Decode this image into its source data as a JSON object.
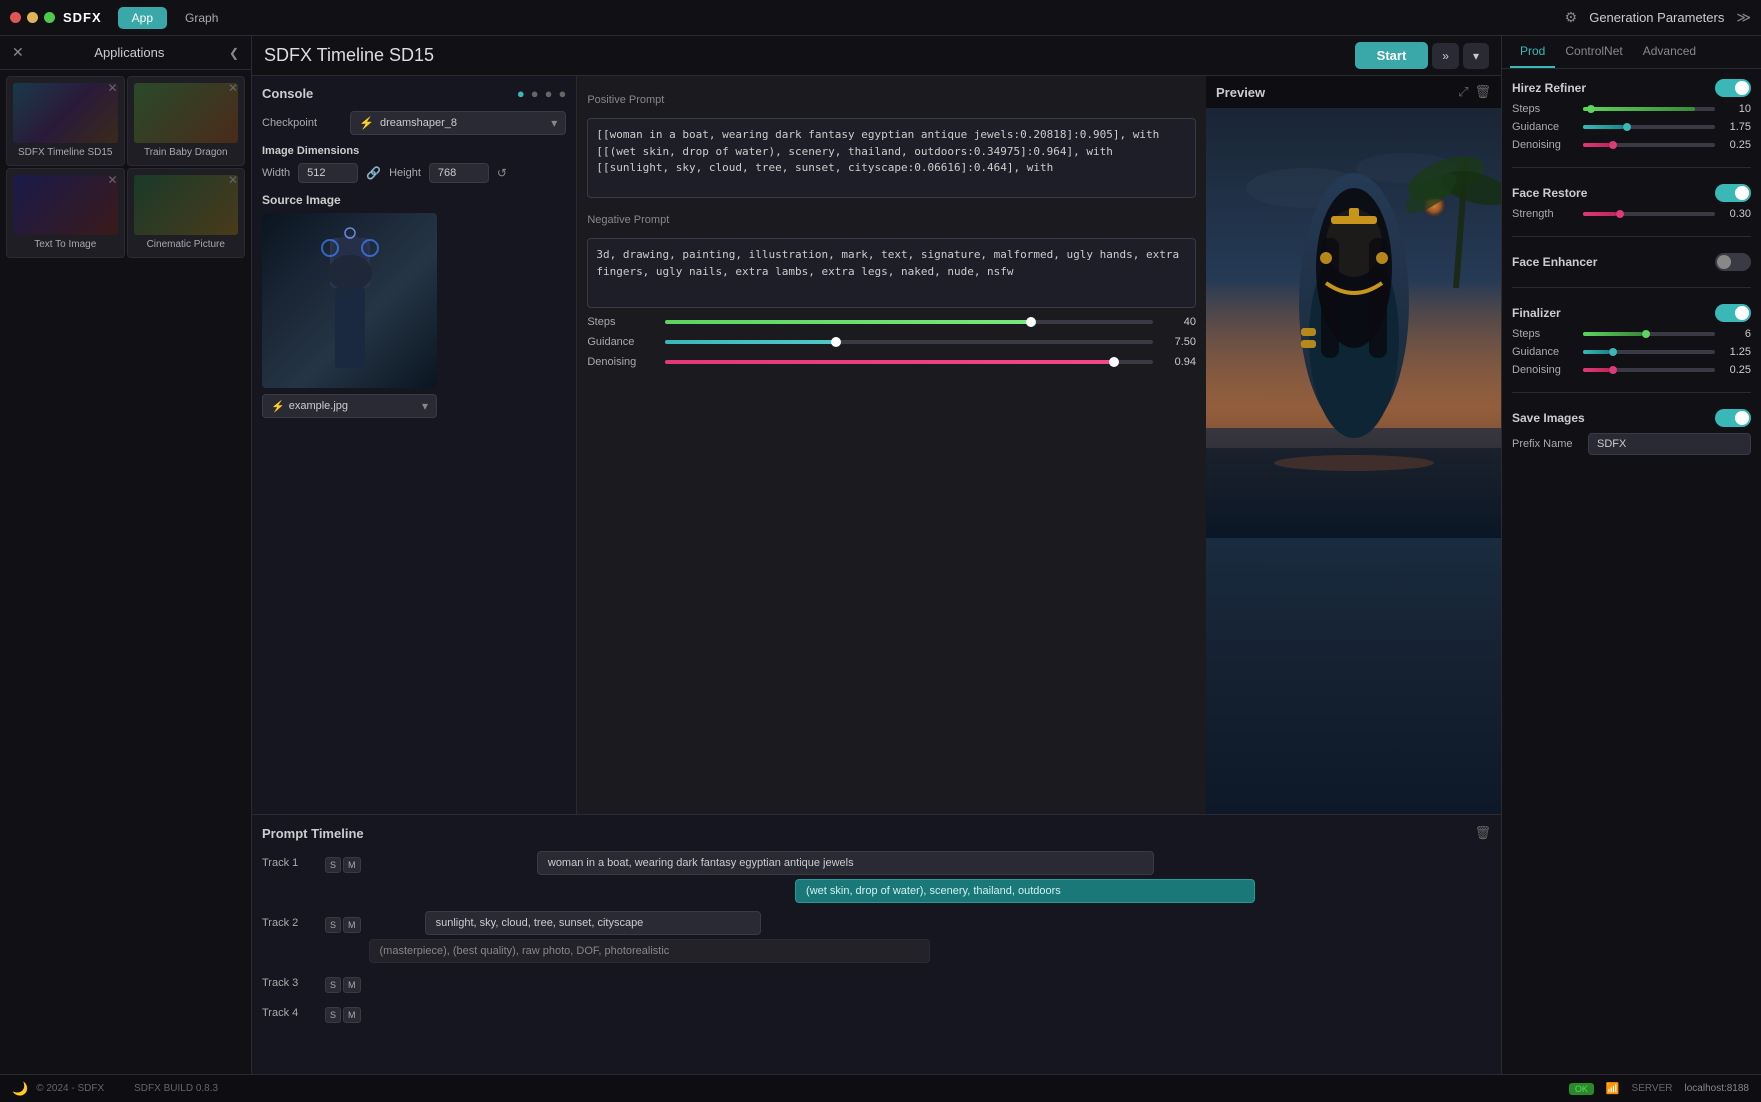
{
  "app": {
    "logo": "SDFX",
    "nav": {
      "app_label": "App",
      "graph_label": "Graph"
    },
    "title": "SDFX Timeline SD15",
    "start_button": "Start",
    "generation_params": "Generation Parameters"
  },
  "sidebar": {
    "title": "Applications",
    "cards": [
      {
        "label": "SDFX Timeline SD15",
        "img_class": "img-sdfx-timeline"
      },
      {
        "label": "Train Baby Dragon",
        "img_class": "img-train-baby"
      },
      {
        "label": "Text To Image",
        "img_class": "img-text-to-image"
      },
      {
        "label": "Cinematic Picture",
        "img_class": "img-cinematic"
      }
    ]
  },
  "console": {
    "title": "Console",
    "checkpoint_label": "Checkpoint",
    "checkpoint_value": "dreamshaper_8",
    "img_dimensions_title": "Image Dimensions",
    "width_label": "Width",
    "height_label": "Height",
    "width_value": "512",
    "height_value": "768",
    "source_image_title": "Source Image",
    "source_img_filename": "example.jpg",
    "positive_prompt_label": "Positive Prompt",
    "positive_prompt_text": "[[woman in a boat, wearing dark fantasy egyptian antique jewels:0.20818]:0.905], with [[(wet skin, drop of water), scenery, thailand, outdoors:0.34975]:0.964], with [[sunlight, sky, cloud, tree, sunset, cityscape:0.06616]:0.464], with",
    "negative_prompt_label": "Negative Prompt",
    "negative_prompt_text": "3d, drawing, painting, illustration, mark, text, signature, malformed, ugly hands, extra fingers, ugly nails, extra lambs, extra legs, naked, nude, nsfw",
    "steps_label": "Steps",
    "steps_value": "40",
    "steps_pct": 75,
    "guidance_label": "Guidance",
    "guidance_value": "7.50",
    "guidance_pct": 35,
    "denoising_label": "Denoising",
    "denoising_value": "0.94",
    "denoising_pct": 92
  },
  "preview": {
    "title": "Preview"
  },
  "timeline": {
    "title": "Prompt Timeline",
    "tracks": [
      {
        "label": "Track 1",
        "segments": [
          {
            "text": "woman in a boat, wearing dark fantasy egyptian antique jewels",
            "style": "normal",
            "width_pct": 55
          },
          {
            "text": "(wet skin, drop of water), scenery, thailand, outdoors",
            "style": "highlight",
            "width_pct": 40
          }
        ]
      },
      {
        "label": "Track 2",
        "segments": [
          {
            "text": "sunlight, sky, cloud, tree, sunset, cityscape",
            "style": "normal",
            "width_pct": 30
          },
          {
            "text": "(masterpiece), (best quality), raw photo, DOF, photorealistic",
            "style": "dark",
            "width_pct": 55
          }
        ]
      },
      {
        "label": "Track 3",
        "segments": []
      },
      {
        "label": "Track 4",
        "segments": []
      }
    ],
    "track_s_btn": "S",
    "track_m_btn": "M"
  },
  "right_panel": {
    "tabs": [
      "Prod",
      "ControlNet",
      "Advanced"
    ],
    "active_tab": "Prod",
    "sections": {
      "hirez_refiner": {
        "title": "Hirez Refiner",
        "enabled": true,
        "steps_label": "Steps",
        "steps_value": "10",
        "steps_pct": 85,
        "guidance_label": "Guidance",
        "guidance_value": "1.75",
        "guidance_pct": 30,
        "denoising_label": "Denoising",
        "denoising_value": "0.25",
        "denoising_pct": 20
      },
      "face_restore": {
        "title": "Face Restore",
        "enabled": true,
        "strength_label": "Strength",
        "strength_value": "0.30",
        "strength_pct": 25
      },
      "face_enhancer": {
        "title": "Face Enhancer",
        "enabled": false
      },
      "finalizer": {
        "title": "Finalizer",
        "enabled": true,
        "steps_label": "Steps",
        "steps_value": "6",
        "steps_pct": 45,
        "guidance_label": "Guidance",
        "guidance_value": "1.25",
        "guidance_pct": 20,
        "denoising_label": "Denoising",
        "denoising_value": "0.25",
        "denoising_pct": 20
      },
      "save_images": {
        "title": "Save Images",
        "enabled": true,
        "prefix_label": "Prefix Name",
        "prefix_value": "SDFX"
      }
    }
  },
  "bottom_bar": {
    "copyright": "© 2024 - SDFX",
    "build": "SDFX BUILD 0.8.3",
    "status": "OK",
    "server_label": "SERVER",
    "localhost": "localhost:8188"
  }
}
